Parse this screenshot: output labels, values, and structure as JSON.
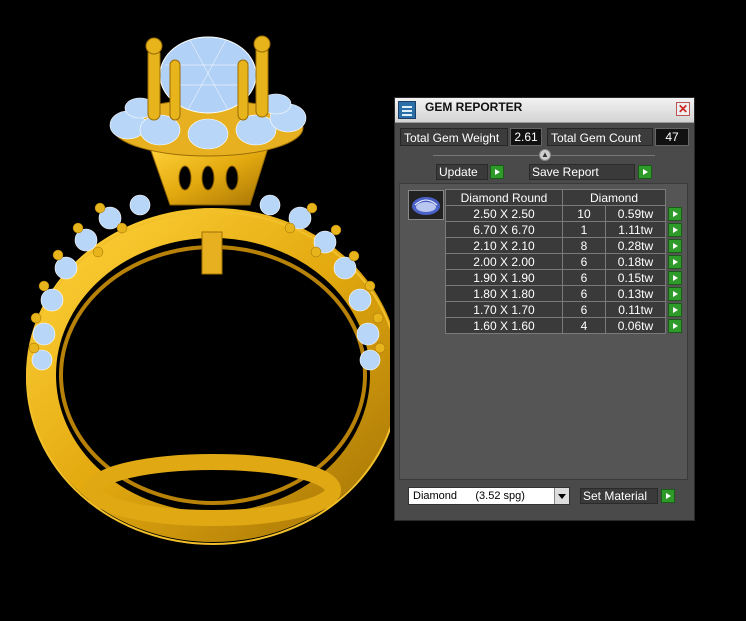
{
  "window": {
    "title": "GEM REPORTER",
    "close_glyph": "✕"
  },
  "totals": {
    "weight_label": "Total Gem Weight",
    "weight_value": "2.61",
    "count_label": "Total Gem Count",
    "count_value": "47"
  },
  "toolbar": {
    "update_label": "Update",
    "save_label": "Save Report"
  },
  "table": {
    "headers": [
      "Diamond Round",
      "Diamond"
    ],
    "rows": [
      {
        "size": "2.50 X 2.50",
        "count": "10",
        "weight": "0.59tw"
      },
      {
        "size": "6.70 X 6.70",
        "count": "1",
        "weight": "1.11tw"
      },
      {
        "size": "2.10 X 2.10",
        "count": "8",
        "weight": "0.28tw"
      },
      {
        "size": "2.00 X 2.00",
        "count": "6",
        "weight": "0.18tw"
      },
      {
        "size": "1.90 X 1.90",
        "count": "6",
        "weight": "0.15tw"
      },
      {
        "size": "1.80 X 1.80",
        "count": "6",
        "weight": "0.13tw"
      },
      {
        "size": "1.70 X 1.70",
        "count": "6",
        "weight": "0.11tw"
      },
      {
        "size": "1.60 X 1.60",
        "count": "4",
        "weight": "0.06tw"
      }
    ]
  },
  "material": {
    "selected": "Diamond      (3.52 spg)",
    "set_label": "Set Material"
  },
  "colors": {
    "gold": "#e8b41c",
    "gold_dark": "#a87a06",
    "gem_blue": "#a9cdf5",
    "panel": "#4a4a4a",
    "green": "#2e9a2a"
  }
}
